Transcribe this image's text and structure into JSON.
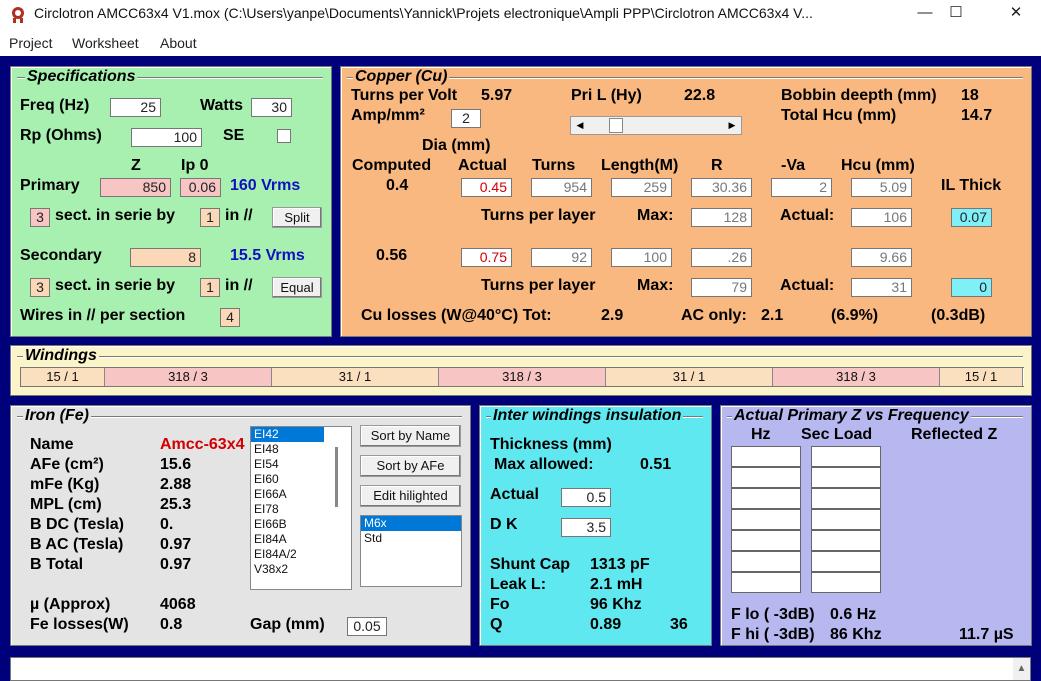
{
  "window": {
    "title": "Circlotron AMCC63x4 V1.mox  (C:\\Users\\yanpe\\Documents\\Yannick\\Projets electronique\\Ampli PPP\\Circlotron AMCC63x4 V...",
    "minimize": "—",
    "maximize": "☐",
    "close": "✕"
  },
  "menu": [
    "Project",
    "Worksheet",
    "About"
  ],
  "spec": {
    "title": "Specifications",
    "freq_label": "Freq (Hz)",
    "freq": "25",
    "watts_label": "Watts",
    "watts": "30",
    "rp_label": "Rp (Ohms)",
    "rp": "100",
    "se_label": "SE",
    "z_head": "Z",
    "ip0_head": "Ip 0",
    "primary_label": "Primary",
    "primary_z": "850",
    "primary_ip0": "0.06",
    "primary_vrms": "160 Vrms",
    "p_sect": "3",
    "sect_text": "sect. in serie by",
    "p_par": "1",
    "par_text": "in //",
    "split_btn": "Split",
    "secondary_label": "Secondary",
    "secondary_z": "8",
    "secondary_vrms": "15.5 Vrms",
    "s_sect": "3",
    "s_par": "1",
    "equal_btn": "Equal",
    "wires_label": "Wires in // per section",
    "wires": "4"
  },
  "copper": {
    "title": "Copper (Cu)",
    "tpv_label": "Turns per Volt",
    "tpv": "5.97",
    "amp_label": "Amp/mm²",
    "amp": "2",
    "pril_label": "Pri L (Hy)",
    "pril": "22.8",
    "bobbin_label": "Bobbin deepth (mm)",
    "bobbin": "18",
    "total_hcu_label": "Total Hcu (mm)",
    "total_hcu": "14.7",
    "dia_head": "Dia (mm)",
    "computed_head": "Computed",
    "actual_head": "Actual",
    "turns_head": "Turns",
    "length_head": "Length(M)",
    "r_head": "R",
    "va_head": "-Va",
    "hcu_head": "Hcu (mm)",
    "il_head": "IL Thick",
    "p_computed": "0.4",
    "p_actual": "0.45",
    "p_turns": "954",
    "p_length": "259",
    "p_r": "30.36",
    "p_va": "2",
    "p_hcu": "5.09",
    "tpl_label": "Turns per layer",
    "max_label": "Max:",
    "actual_label": "Actual:",
    "p_max": "128",
    "p_act": "106",
    "p_il": "0.07",
    "s_computed": "0.56",
    "s_actual": "0.75",
    "s_turns": "92",
    "s_length": "100",
    "s_r": ".26",
    "s_hcu": "9.66",
    "s_max": "79",
    "s_act": "31",
    "s_il": "0",
    "losses_label": "Cu losses (W@40°C) Tot:",
    "losses_tot": "2.9",
    "ac_label": "AC only:",
    "ac_only": "2.1",
    "pct": "(6.9%)",
    "db": "(0.3dB)"
  },
  "windings": {
    "title": "Windings",
    "segments": [
      {
        "label": "15 / 1",
        "color": "#fbe0c0",
        "w": 84
      },
      {
        "label": "318 / 3",
        "color": "#f7c5c4",
        "w": 167
      },
      {
        "label": "31 / 1",
        "color": "#fbe0c0",
        "w": 167
      },
      {
        "label": "318 / 3",
        "color": "#f7c5c4",
        "w": 167
      },
      {
        "label": "31 / 1",
        "color": "#fbe0c0",
        "w": 167
      },
      {
        "label": "318 / 3",
        "color": "#f7c5c4",
        "w": 167
      },
      {
        "label": "15 / 1",
        "color": "#fbe0c0",
        "w": 83
      }
    ]
  },
  "iron": {
    "title": "Iron (Fe)",
    "name_label": "Name",
    "name": "Amcc-63x4",
    "afe_label": "AFe (cm²)",
    "afe": "15.6",
    "mfe_label": "mFe (Kg)",
    "mfe": "2.88",
    "mpl_label": "MPL (cm)",
    "mpl": "25.3",
    "bdc_label": "B DC (Tesla)",
    "bdc": "0.",
    "bac_label": "B AC (Tesla)",
    "bac": "0.97",
    "btot_label": "B Total",
    "btot": "0.97",
    "mu_label": "µ (Approx)",
    "mu": "4068",
    "fel_label": "Fe losses(W)",
    "fel": "0.8",
    "gap_label": "Gap (mm)",
    "gap": "0.05",
    "cores": [
      "EI42",
      "EI48",
      "EI54",
      "EI60",
      "EI66A",
      "EI78",
      "EI66B",
      "EI84A",
      "EI84A/2",
      "V38x2"
    ],
    "sort_name": "Sort by Name",
    "sort_afe": "Sort by AFe",
    "edit": "Edit hilighted",
    "materials": [
      "M6x",
      "Std"
    ]
  },
  "insulation": {
    "title": "Inter windings insulation",
    "thick_label": "Thickness (mm)",
    "max_label": "Max allowed:",
    "max": "0.51",
    "actual_label": "Actual",
    "actual": "0.5",
    "dk_label": "D K",
    "dk": "3.5",
    "shunt_label": "Shunt Cap",
    "shunt": "1313 pF",
    "leak_label": "Leak L:",
    "leak": "2.1 mH",
    "fo_label": "Fo",
    "fo": "96 Khz",
    "q_label": "Q",
    "q": "0.89",
    "q2": "36"
  },
  "freq": {
    "title": "Actual Primary Z vs Frequency",
    "hz_head": "Hz",
    "sec_head": "Sec Load",
    "refl_head": "Reflected Z",
    "flo_label": "F lo ( -3dB)",
    "flo": "0.6 Hz",
    "fhi_label": "F hi ( -3dB)",
    "fhi": "86 Khz",
    "rise": "11.7 µS"
  },
  "colors": {
    "client": "#00007a",
    "spec": "#a8f0b0",
    "copper": "#f8b880",
    "windings": "#fbf4c8",
    "iron": "#e4e4e4",
    "insul": "#60e8f0",
    "freq": "#b8b8f0"
  }
}
